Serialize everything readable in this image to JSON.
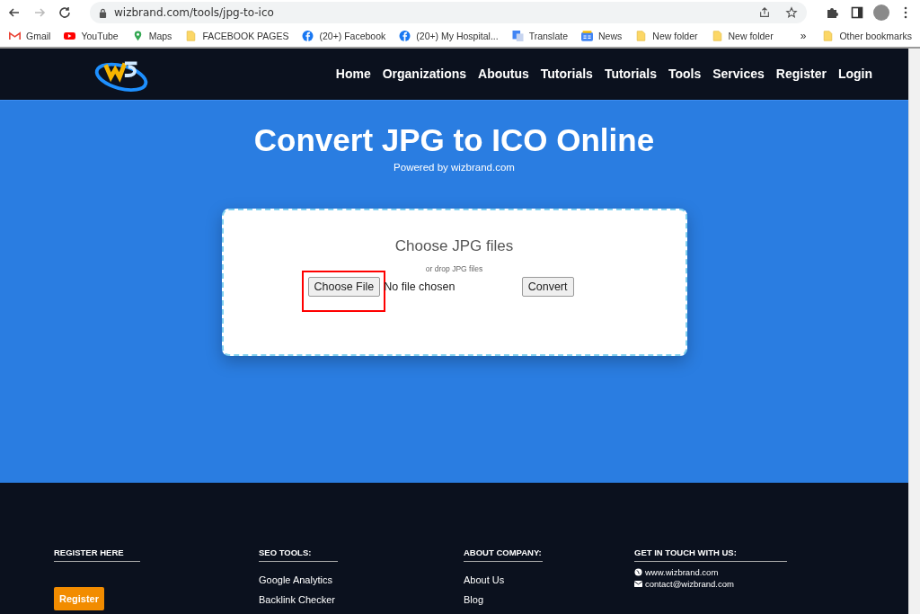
{
  "browser": {
    "url": "wizbrand.com/tools/jpg-to-ico",
    "bookmarks": [
      {
        "label": "Gmail",
        "kind": "gmail"
      },
      {
        "label": "YouTube",
        "kind": "youtube"
      },
      {
        "label": "Maps",
        "kind": "maps"
      },
      {
        "label": "FACEBOOK PAGES",
        "kind": "folder"
      },
      {
        "label": "(20+) Facebook",
        "kind": "facebook"
      },
      {
        "label": "(20+) My Hospital...",
        "kind": "facebook"
      },
      {
        "label": "Translate",
        "kind": "translate"
      },
      {
        "label": "News",
        "kind": "news"
      },
      {
        "label": "New folder",
        "kind": "folder"
      },
      {
        "label": "New folder",
        "kind": "folder"
      }
    ],
    "overflow": "»",
    "other_bookmarks": "Other bookmarks"
  },
  "nav": {
    "items": [
      "Home",
      "Organizations",
      "Aboutus",
      "Tutorials",
      "Tutorials",
      "Tools",
      "Services",
      "Register",
      "Login"
    ]
  },
  "hero": {
    "title": "Convert JPG to ICO Online",
    "subtitle": "Powered by wizbrand.com"
  },
  "upload": {
    "heading": "Choose JPG files",
    "hint": "or drop JPG files",
    "choose_button": "Choose File",
    "file_status": "No file chosen",
    "convert_button": "Convert",
    "highlighted": true
  },
  "footer": {
    "columns": [
      {
        "heading": "REGISTER HERE",
        "kind": "button",
        "items": [
          "Register"
        ]
      },
      {
        "heading": "SEO TOOLS:",
        "kind": "links",
        "items": [
          "Google Analytics",
          "Backlink Checker"
        ]
      },
      {
        "heading": "ABOUT COMPANY:",
        "kind": "links",
        "items": [
          "About Us",
          "Blog"
        ]
      },
      {
        "heading": "GET IN TOUCH WITH US:",
        "kind": "contact",
        "items": [
          "www.wizbrand.com",
          "contact@wizbrand.com"
        ]
      }
    ]
  }
}
